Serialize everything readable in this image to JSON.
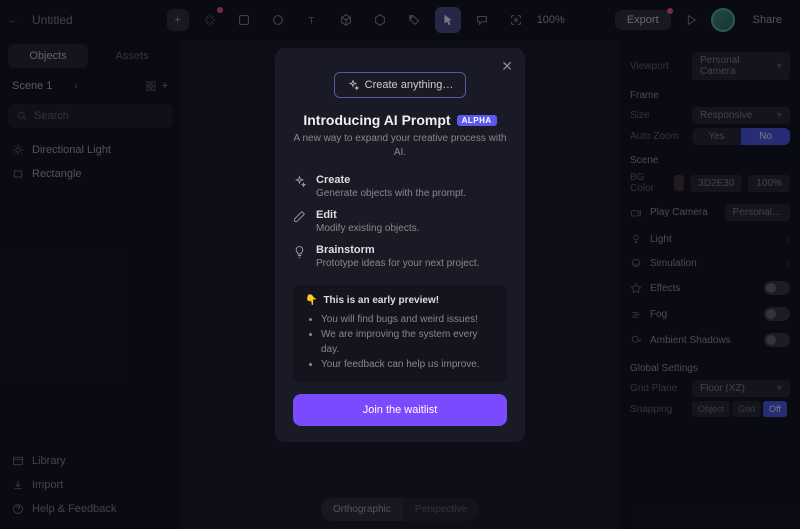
{
  "topbar": {
    "title": "Untitled",
    "zoom": "100%",
    "export": "Export",
    "share": "Share"
  },
  "left": {
    "tabs": [
      "Objects",
      "Assets"
    ],
    "scene": "Scene 1",
    "search_placeholder": "Search",
    "items": [
      {
        "icon": "light",
        "label": "Directional Light"
      },
      {
        "icon": "rect",
        "label": "Rectangle"
      }
    ],
    "bottom": [
      {
        "icon": "lib",
        "label": "Library"
      },
      {
        "icon": "import",
        "label": "Import"
      },
      {
        "icon": "help",
        "label": "Help & Feedback"
      }
    ]
  },
  "view_toggle": {
    "a": "Orthographic",
    "b": "Perspective"
  },
  "right": {
    "viewport_label": "Viewport",
    "viewport_value": "Personal Camera",
    "frame_label": "Frame",
    "size_label": "Size",
    "size_value": "Responsive",
    "autozoom_label": "Auto Zoom",
    "autozoom": [
      "Yes",
      "No"
    ],
    "scene_label": "Scene",
    "bgcolor_label": "BG Color",
    "bgcolor_hex": "3D2E30",
    "bgcolor_pct": "100%",
    "playcam_label": "Play Camera",
    "playcam_value": "Personal…",
    "props": [
      {
        "name": "light",
        "label": "Light",
        "chev": true
      },
      {
        "name": "simulation",
        "label": "Simulation",
        "chev": true
      },
      {
        "name": "effects",
        "label": "Effects",
        "toggle": true
      },
      {
        "name": "fog",
        "label": "Fog",
        "toggle": true
      },
      {
        "name": "ambient",
        "label": "Ambient Shadows",
        "toggle": true
      }
    ],
    "global_label": "Global Settings",
    "gridplane_label": "Grid Plane",
    "gridplane_value": "Floor (XZ)",
    "snapping_label": "Snapping",
    "snapping": [
      "Object",
      "Grid",
      "Off"
    ]
  },
  "modal": {
    "pill": "Create anything…",
    "title": "Introducing AI Prompt",
    "badge": "ALPHA",
    "subtitle": "A new way to expand your creative process with AI.",
    "features": [
      {
        "icon": "sparkle",
        "title": "Create",
        "desc": "Generate objects with the prompt."
      },
      {
        "icon": "pencil",
        "title": "Edit",
        "desc": "Modify existing objects."
      },
      {
        "icon": "bulb",
        "title": "Brainstorm",
        "desc": "Prototype ideas for your next project."
      }
    ],
    "early_title": "This is an early preview!",
    "early_points": [
      "You will find bugs and weird issues!",
      "We are improving the system every day.",
      "Your feedback can help us improve."
    ],
    "cta": "Join the waitlist"
  }
}
